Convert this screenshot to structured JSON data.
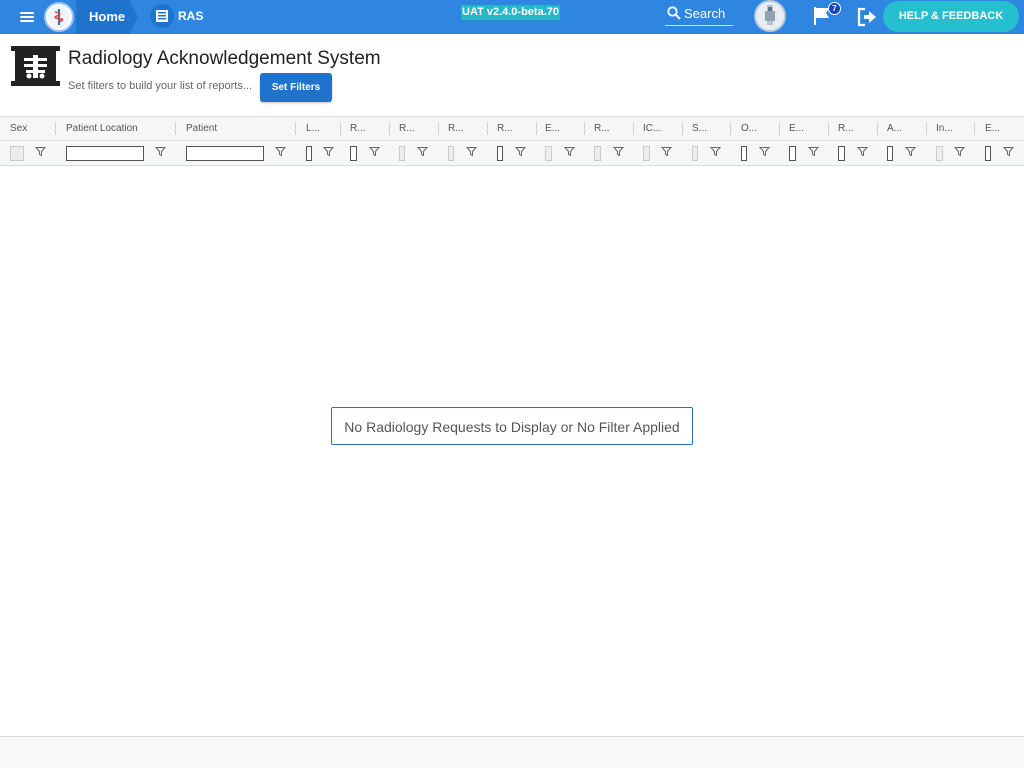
{
  "topbar": {
    "home_label": "Home",
    "app_label": "RAS",
    "version": "UAT v2.4.0-beta.70",
    "search_label": "Search",
    "flag_count": "7",
    "help_label": "HELP & FEEDBACK",
    "colors": {
      "bar": "#2f86e0",
      "crumb": "#1f73cc",
      "accent": "#26bfd0"
    }
  },
  "header": {
    "title": "Radiology Acknowledgement System",
    "hint": "Set filters to build your list of reports...",
    "set_filters_label": "Set Filters"
  },
  "grid": {
    "columns": [
      "Sex",
      "Patient Location",
      "Patient",
      "L...",
      "R...",
      "R...",
      "R...",
      "R...",
      "E...",
      "R...",
      "IC...",
      "S...",
      "O...",
      "E...",
      "R...",
      "A...",
      "In...",
      "E..."
    ],
    "empty_message": "No Radiology Requests to Display or No Filter Applied"
  }
}
